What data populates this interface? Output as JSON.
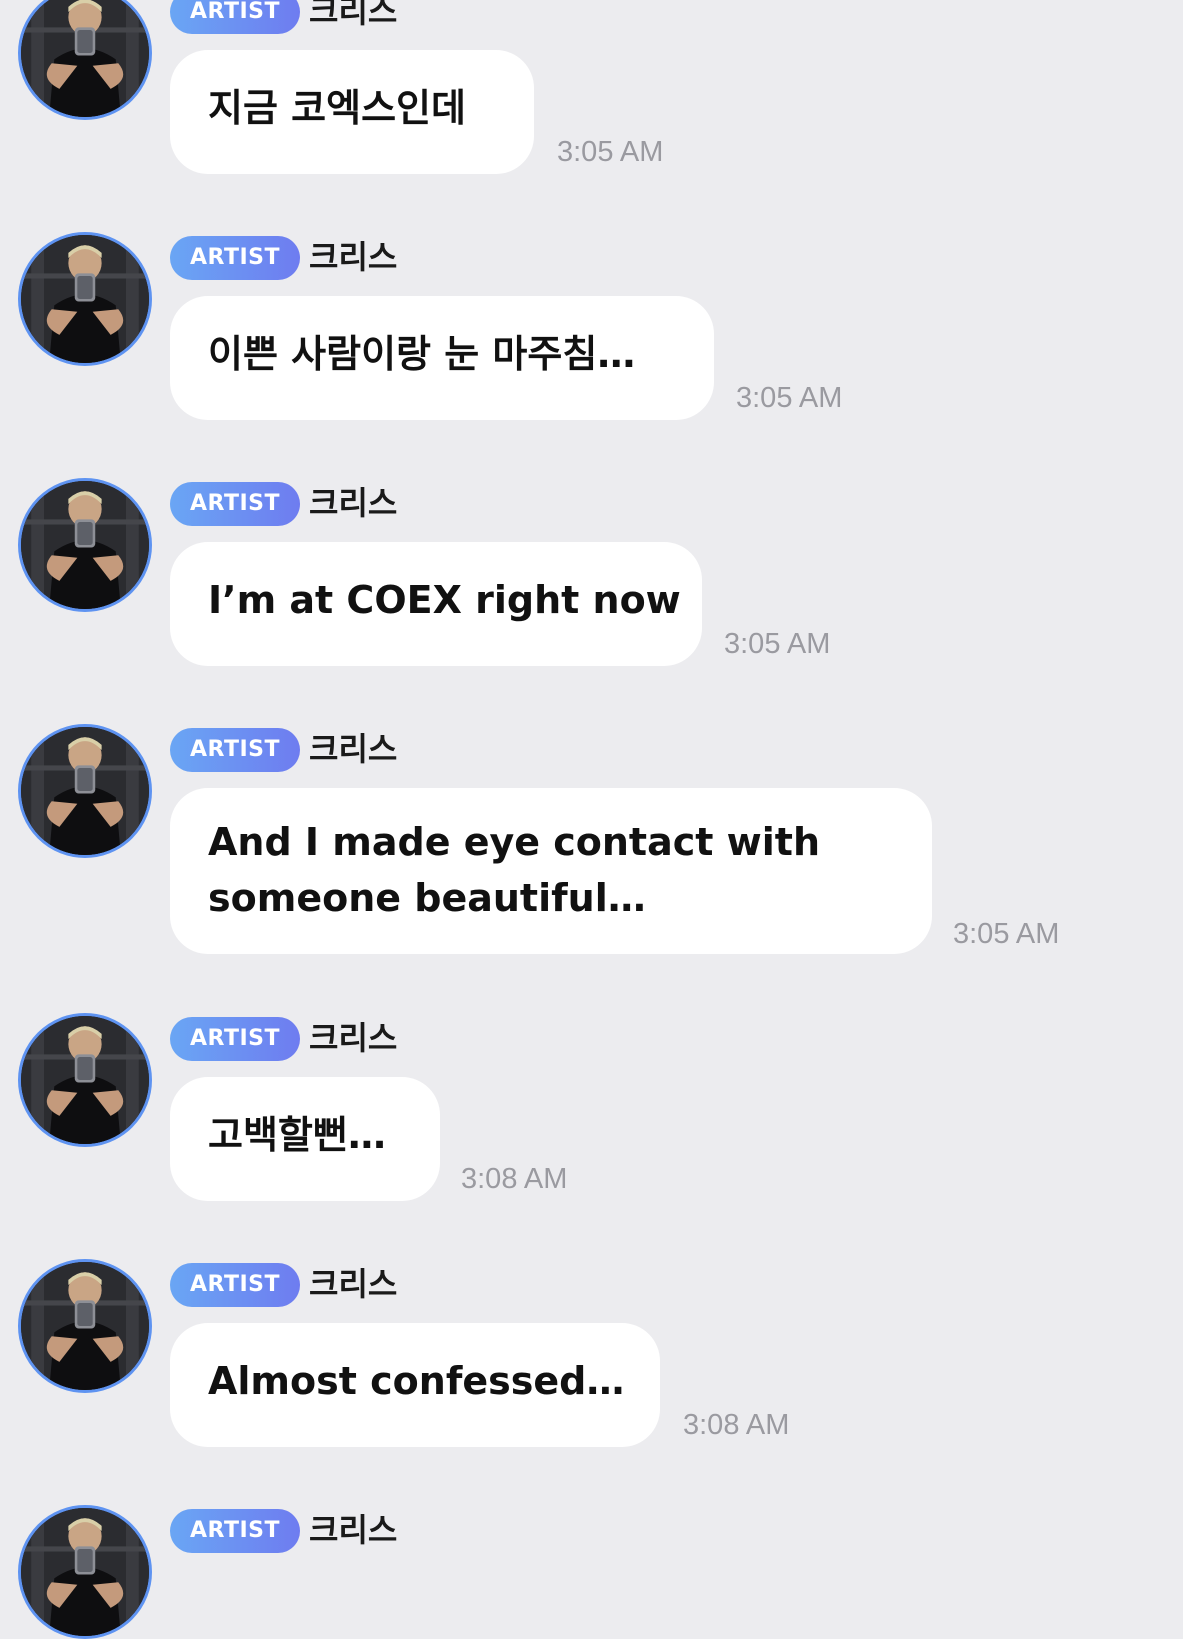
{
  "messages": [
    {
      "badge": "ARTIST",
      "sender": "크리스",
      "text": "지금 코엑스인데",
      "time": "3:05 AM"
    },
    {
      "badge": "ARTIST",
      "sender": "크리스",
      "text": "이쁜 사람이랑 눈 마주침…",
      "time": "3:05 AM"
    },
    {
      "badge": "ARTIST",
      "sender": "크리스",
      "text": "I’m at COEX right now",
      "time": "3:05 AM"
    },
    {
      "badge": "ARTIST",
      "sender": "크리스",
      "text": "And I made eye contact with someone beautiful…",
      "time": "3:05 AM"
    },
    {
      "badge": "ARTIST",
      "sender": "크리스",
      "text": "고백할뻔…",
      "time": "3:08 AM"
    },
    {
      "badge": "ARTIST",
      "sender": "크리스",
      "text": "Almost confessed…",
      "time": "3:08 AM"
    },
    {
      "badge": "ARTIST",
      "sender": "크리스"
    }
  ]
}
